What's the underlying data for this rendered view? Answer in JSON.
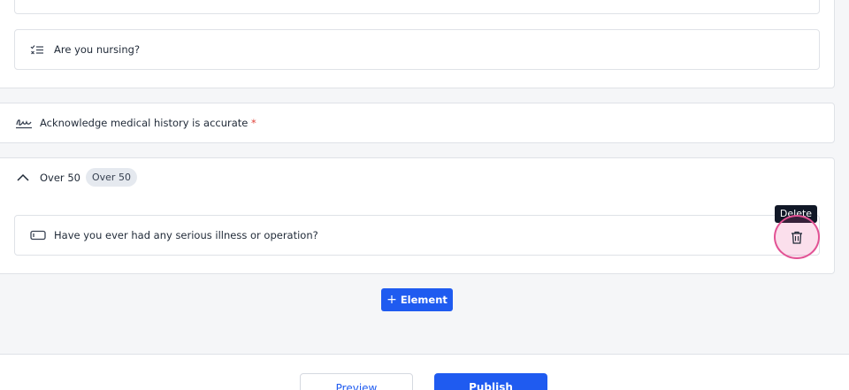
{
  "outer_section": {
    "nested_question": {
      "label": "Are you nursing?",
      "icon": "checklist-icon"
    }
  },
  "acknowledge": {
    "label": "Acknowledge medical history is accurate",
    "required_mark": "*",
    "icon": "signature-icon"
  },
  "group": {
    "title": "Over 50",
    "badge": "Over 50",
    "toggle_icon": "chevron-up-icon",
    "question": {
      "label": "Have you ever had any serious illness or operation?",
      "icon": "text-field-icon"
    }
  },
  "delete_tooltip": "Delete",
  "add_element": {
    "plus": "+",
    "label": "Element"
  },
  "footer": {
    "preview_label": "Preview",
    "publish_label": "Publish"
  },
  "colors": {
    "accent": "#1f5bf0",
    "required": "#e0433b",
    "delete_highlight": "#e25294"
  }
}
